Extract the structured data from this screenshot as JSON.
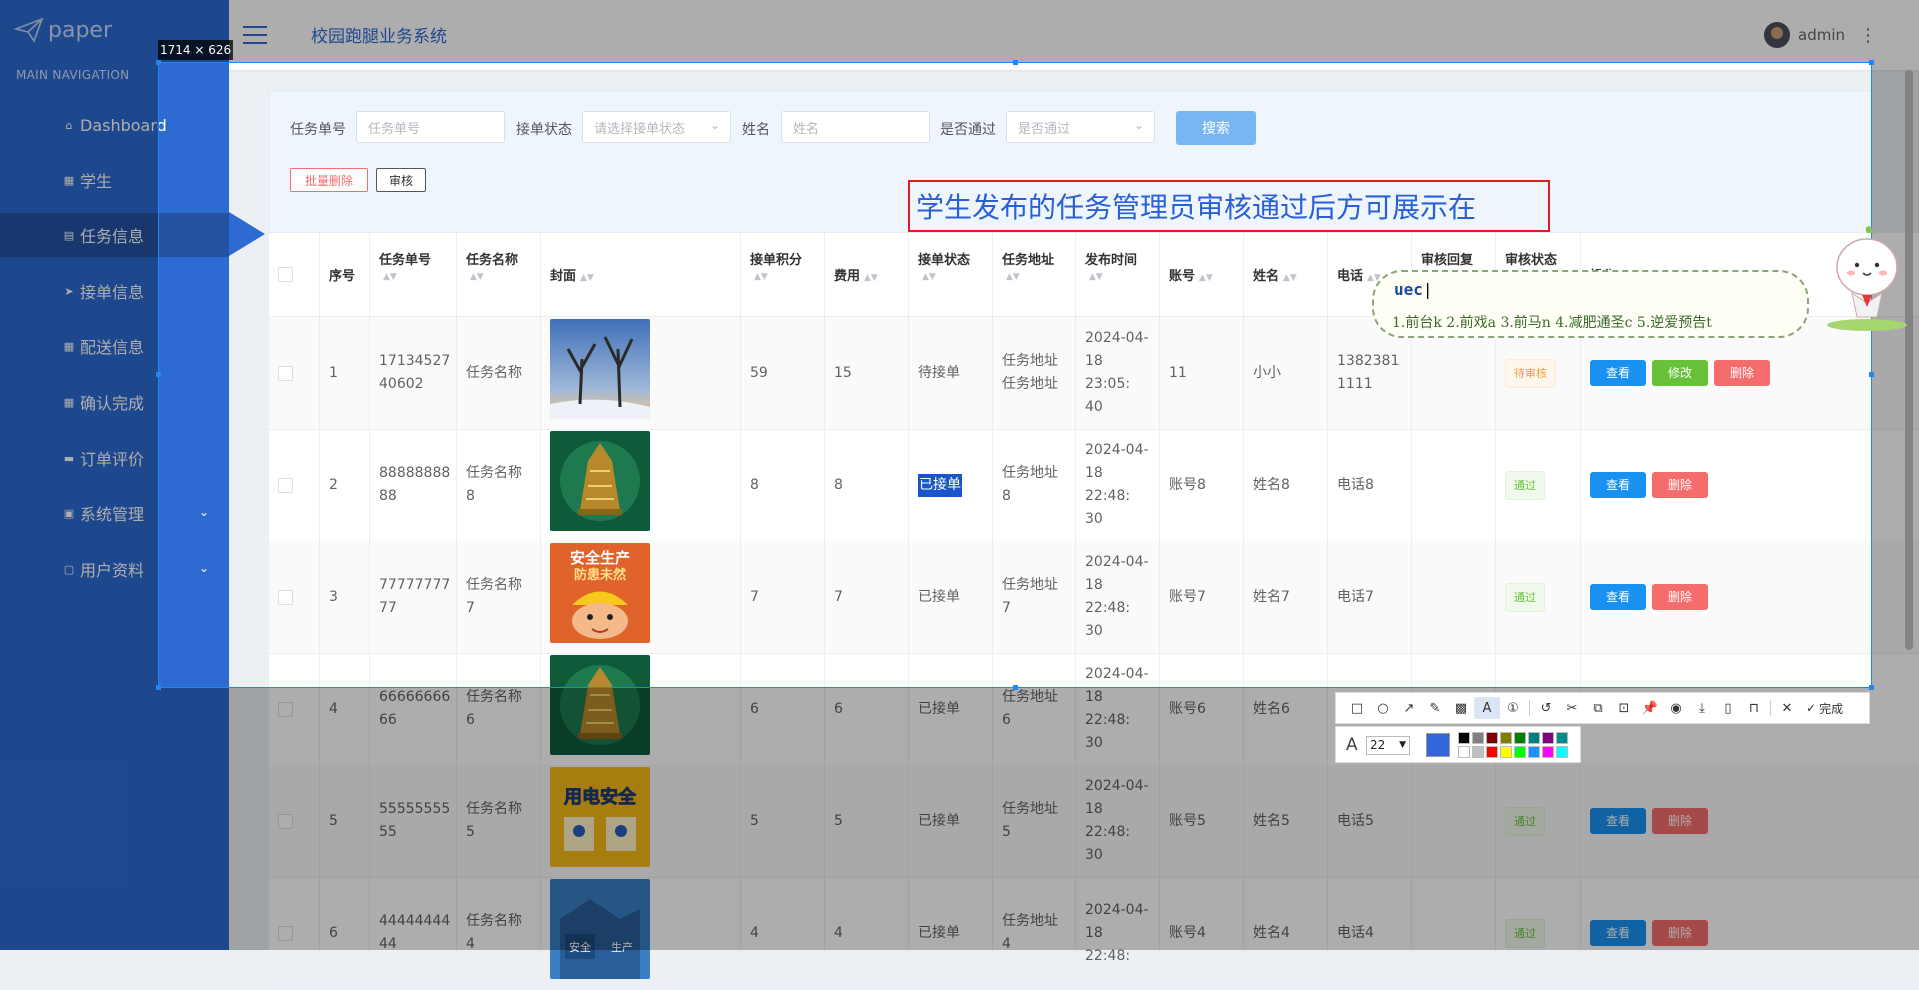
{
  "app": {
    "logo_text": "paper",
    "title": "校园跑腿业务系统",
    "user": "admin"
  },
  "sidebar": {
    "header": "MAIN NAVIGATION",
    "items": [
      {
        "label": "Dashboard",
        "icon": "home-icon"
      },
      {
        "label": "学生",
        "icon": "grid-icon"
      },
      {
        "label": "任务信息",
        "icon": "doc-icon",
        "active": true
      },
      {
        "label": "接单信息",
        "icon": "send-icon"
      },
      {
        "label": "配送信息",
        "icon": "grid-icon"
      },
      {
        "label": "确认完成",
        "icon": "grid-icon"
      },
      {
        "label": "订单评价",
        "icon": "comment-icon"
      },
      {
        "label": "系统管理",
        "icon": "lock-icon",
        "expandable": true
      },
      {
        "label": "用户资料",
        "icon": "user-icon",
        "expandable": true
      }
    ]
  },
  "search": {
    "task_no_label": "任务单号",
    "task_no_placeholder": "任务单号",
    "status_label": "接单状态",
    "status_placeholder": "请选择接单状态",
    "name_label": "姓名",
    "name_placeholder": "姓名",
    "pass_label": "是否通过",
    "pass_placeholder": "是否通过",
    "search_button": "搜索",
    "batch_delete": "批量删除",
    "audit": "审核"
  },
  "table": {
    "headers": [
      "序号",
      "任务单号",
      "任务名称",
      "封面",
      "接单积分",
      "费用",
      "接单状态",
      "任务地址",
      "发布时间",
      "账号",
      "姓名",
      "电话",
      "审核回复",
      "审核状态",
      "操作"
    ],
    "rows": [
      {
        "idx": "1",
        "no_a": "17134527",
        "no_b": "40602",
        "name_a": "任务名称",
        "name_b": "",
        "points": "59",
        "fee": "15",
        "status": "待接单",
        "addr_a": "任务地址",
        "addr_b": "任务地址",
        "time_a": "2024-04-",
        "time_b": "18 23:05:",
        "time_c": "40",
        "account": "11",
        "person": "小小",
        "phone_a": "1382381",
        "phone_b": "1111",
        "reply": "",
        "audit": "待审核",
        "audit_kind": "pending",
        "actions": [
          "查看",
          "修改",
          "删除"
        ],
        "cover": "trees"
      },
      {
        "idx": "2",
        "no_a": "88888888",
        "no_b": "88",
        "name_a": "任务名称",
        "name_b": "8",
        "points": "8",
        "fee": "8",
        "status": "已接单",
        "addr_a": "任务地址",
        "addr_b": "8",
        "time_a": "2024-04-",
        "time_b": "18 22:48:",
        "time_c": "30",
        "account": "账号8",
        "person": "姓名8",
        "phone_a": "电话8",
        "phone_b": "",
        "reply": "",
        "audit": "通过",
        "audit_kind": "pass",
        "actions": [
          "查看",
          "删除"
        ],
        "cover": "bell"
      },
      {
        "idx": "3",
        "no_a": "77777777",
        "no_b": "77",
        "name_a": "任务名称",
        "name_b": "7",
        "points": "7",
        "fee": "7",
        "status": "已接单",
        "addr_a": "任务地址",
        "addr_b": "7",
        "time_a": "2024-04-",
        "time_b": "18 22:48:",
        "time_c": "30",
        "account": "账号7",
        "person": "姓名7",
        "phone_a": "电话7",
        "phone_b": "",
        "reply": "",
        "audit": "通过",
        "audit_kind": "pass",
        "actions": [
          "查看",
          "删除"
        ],
        "cover": "safety"
      },
      {
        "idx": "4",
        "no_a": "66666666",
        "no_b": "66",
        "name_a": "任务名称",
        "name_b": "6",
        "points": "6",
        "fee": "6",
        "status": "已接单",
        "addr_a": "任务地址",
        "addr_b": "6",
        "time_a": "2024-04-",
        "time_b": "18 22:48:",
        "time_c": "30",
        "account": "账号6",
        "person": "姓名6",
        "phone_a": "电话6",
        "phone_b": "",
        "reply": "",
        "audit": "",
        "audit_kind": "",
        "actions": [],
        "cover": "bell"
      },
      {
        "idx": "5",
        "no_a": "55555555",
        "no_b": "55",
        "name_a": "任务名称",
        "name_b": "5",
        "points": "5",
        "fee": "5",
        "status": "已接单",
        "addr_a": "任务地址",
        "addr_b": "5",
        "time_a": "2024-04-",
        "time_b": "18 22:48:",
        "time_c": "30",
        "account": "账号5",
        "person": "姓名5",
        "phone_a": "电话5",
        "phone_b": "",
        "reply": "",
        "audit": "通过",
        "audit_kind": "pass",
        "actions": [
          "查看",
          "删除"
        ],
        "cover": "yellow"
      },
      {
        "idx": "6",
        "no_a": "44444444",
        "no_b": "44",
        "name_a": "任务名称",
        "name_b": "4",
        "points": "4",
        "fee": "4",
        "status": "已接单",
        "addr_a": "任务地址",
        "addr_b": "4",
        "time_a": "2024-04-",
        "time_b": "18 22:48:",
        "time_c": "",
        "account": "账号4",
        "person": "姓名4",
        "phone_a": "电话4",
        "phone_b": "",
        "reply": "",
        "audit": "通过",
        "audit_kind": "pass",
        "actions": [
          "查看",
          "删除"
        ],
        "cover": "blue"
      }
    ]
  },
  "screenshot_tool": {
    "size_label": "1714 × 626",
    "annotation_text": "学生发布的任务管理员审核通过后方可展示在",
    "font_size": "22",
    "done_label": "完成",
    "current_color": "#3366dd",
    "palette": [
      "#000000",
      "#808080",
      "#800000",
      "#808000",
      "#008000",
      "#008080",
      "#800080",
      "#008b8b",
      "#ffffff",
      "#c0c0c0",
      "#ff0000",
      "#ffff00",
      "#00ff00",
      "#1e90ff",
      "#ff00ff",
      "#00ffff"
    ]
  },
  "ime": {
    "composition": "uec",
    "candidates": "1.前台k  2.前戏a  3.前马n  4.减肥通圣c  5.逆爱预告t"
  }
}
